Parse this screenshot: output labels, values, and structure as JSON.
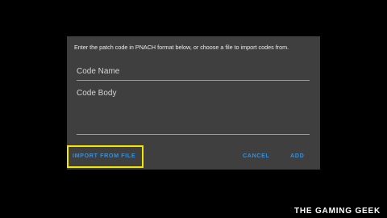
{
  "dialog": {
    "instructions": "Enter the patch code in PNACH format below, or choose a file to import codes from.",
    "code_name_placeholder": "Code Name",
    "code_body_placeholder": "Code Body",
    "buttons": {
      "import_label": "IMPORT FROM FILE",
      "cancel_label": "CANCEL",
      "add_label": "ADD"
    }
  },
  "watermark": {
    "text": "THE GAMING GEEK"
  },
  "colors": {
    "background": "#000000",
    "dialog": "#3f3f3f",
    "accent": "#3a8ed6",
    "highlight": "#f3e600"
  }
}
